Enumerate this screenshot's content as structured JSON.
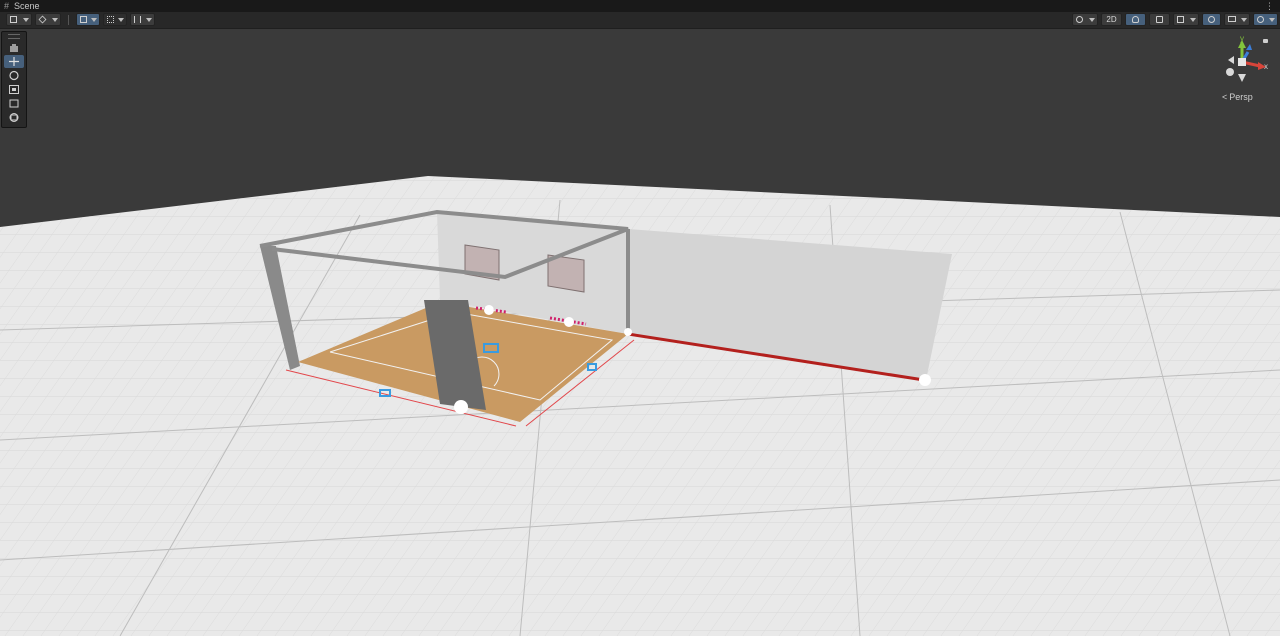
{
  "window": {
    "tab_icon": "grid-hash-icon",
    "tab_label": "Scene",
    "more_icon": "more-vert-icon",
    "more_glyph": "⋮"
  },
  "toolbar": {
    "button_2d_label": "2D",
    "left_tools": [
      "draw-mode-icon",
      "cube-icon",
      "move-snap-icon",
      "grid-snap-icon",
      "increment-snap-icon"
    ],
    "right_tools": [
      "shading-icon",
      "lighting-icon",
      "audio-icon",
      "effects-icon",
      "hidden-objects-icon",
      "camera-icon",
      "gizmos-icon"
    ]
  },
  "tools_panel": {
    "items": [
      "hand-tool",
      "move-tool",
      "rotate-tool",
      "scale-tool",
      "rect-tool",
      "transform-tool"
    ],
    "selected": "move-tool"
  },
  "orientation_gizmo": {
    "y_label": "y",
    "x_label": "x",
    "projection_label": "Persp",
    "projection_arrow": "<"
  },
  "colors": {
    "background": "#383838",
    "ground": "#e8e8e8",
    "wall": "#d6d6d6",
    "floor": "#c99a62",
    "selected_edge": "#c0201e",
    "tool_selected": "#46607c",
    "axis_x": "#d9453a",
    "axis_y": "#82c43c",
    "axis_z": "#3b7ed9"
  }
}
